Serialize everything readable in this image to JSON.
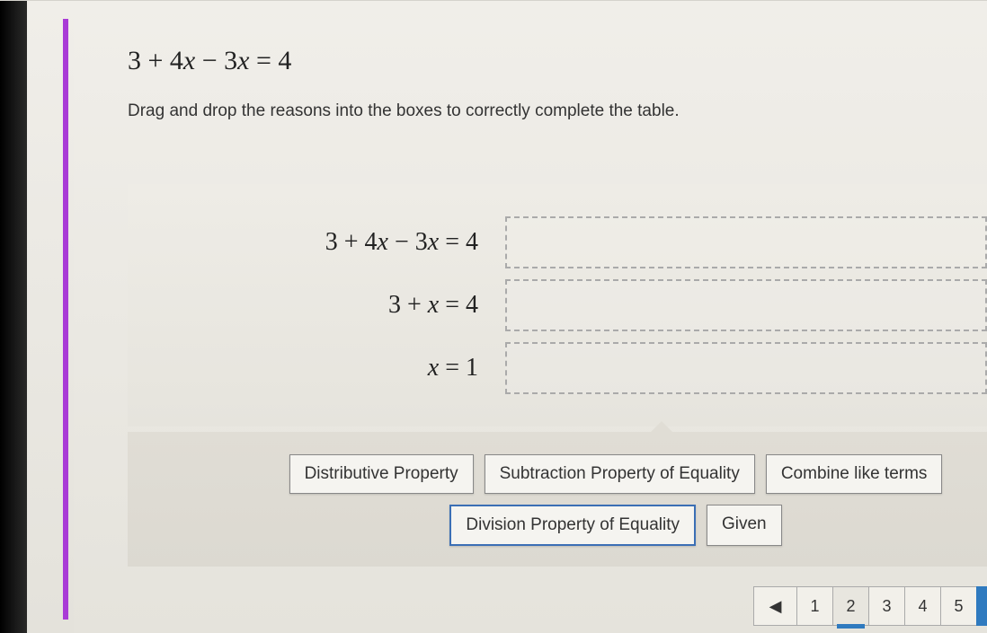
{
  "header": {
    "equation_parts": [
      "3 + 4",
      "x",
      " − 3",
      "x",
      " = 4"
    ],
    "instruction": "Drag and drop the reasons into the boxes to correctly complete the table."
  },
  "proof": {
    "steps": [
      {
        "parts": [
          "3 + 4",
          "x",
          " − 3",
          "x",
          " = 4"
        ]
      },
      {
        "parts": [
          "3 + ",
          "x",
          " = 4"
        ]
      },
      {
        "parts": [
          "",
          "x",
          " = 1"
        ]
      }
    ]
  },
  "tiles": {
    "row1": [
      {
        "label": "Distributive Property",
        "selected": false
      },
      {
        "label": "Subtraction Property of Equality",
        "selected": false
      },
      {
        "label": "Combine like terms",
        "selected": false
      }
    ],
    "row2": [
      {
        "label": "Division Property of Equality",
        "selected": true
      },
      {
        "label": "Given",
        "selected": false
      }
    ]
  },
  "pager": {
    "prev_glyph": "◀",
    "pages": [
      "1",
      "2",
      "3",
      "4",
      "5"
    ],
    "active_index": 1
  }
}
